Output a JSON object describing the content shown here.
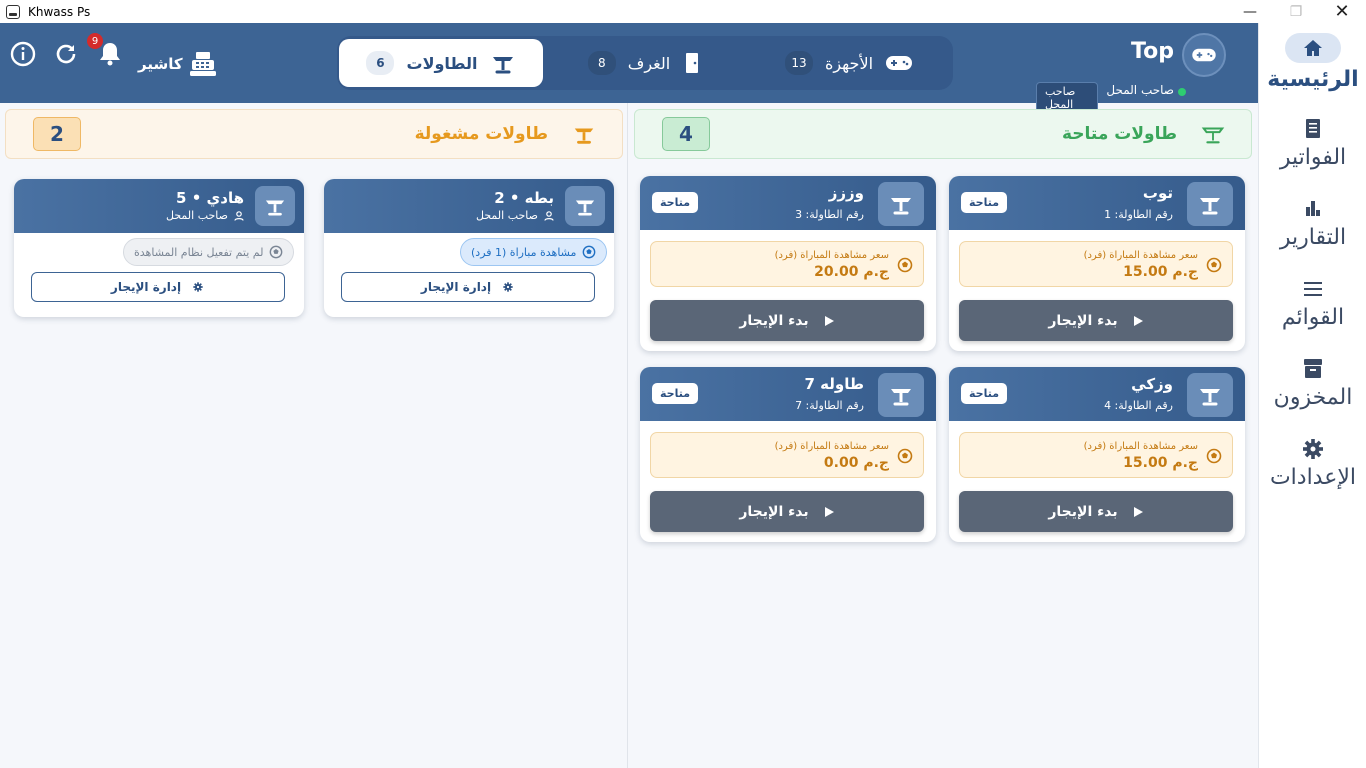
{
  "window": {
    "title": "Khwass Ps"
  },
  "sidebar": {
    "items": [
      {
        "label": "الرئيسية",
        "icon": "home-icon"
      },
      {
        "label": "الفواتير",
        "icon": "receipt-icon"
      },
      {
        "label": "التقارير",
        "icon": "bar-chart-icon"
      },
      {
        "label": "القوائم",
        "icon": "menu-icon"
      },
      {
        "label": "المخزون",
        "icon": "archive-icon"
      },
      {
        "label": "الإعدادات",
        "icon": "gear-icon"
      }
    ]
  },
  "header": {
    "notifications": "9",
    "cashier_label": "كاشير",
    "tabs": [
      {
        "label": "الطاولات",
        "count": "6"
      },
      {
        "label": "الغرف",
        "count": "8"
      },
      {
        "label": "الأجهزة",
        "count": "13"
      }
    ],
    "user": {
      "name": "Top",
      "role": "صاحب المحل",
      "role_badge": "صاحب المحل"
    }
  },
  "available": {
    "title": "طاولات متاحة",
    "count": "4",
    "cards": [
      {
        "name": "توب",
        "number": "رقم الطاولة: 1",
        "status": "متاحة",
        "price_label": "سعر مشاهدة المباراة (فرد)",
        "price": "15.00 ج.م",
        "action": "بدء الإيجار"
      },
      {
        "name": "وززز",
        "number": "رقم الطاولة: 3",
        "status": "متاحة",
        "price_label": "سعر مشاهدة المباراة (فرد)",
        "price": "20.00 ج.م",
        "action": "بدء الإيجار"
      },
      {
        "name": "وزكي",
        "number": "رقم الطاولة: 4",
        "status": "متاحة",
        "price_label": "سعر مشاهدة المباراة (فرد)",
        "price": "15.00 ج.م",
        "action": "بدء الإيجار"
      },
      {
        "name": "طاوله 7",
        "number": "رقم الطاولة: 7",
        "status": "متاحة",
        "price_label": "سعر مشاهدة المباراة (فرد)",
        "price": "0.00 ج.م",
        "action": "بدء الإيجار"
      }
    ]
  },
  "busy": {
    "title": "طاولات مشغولة",
    "count": "2",
    "cards": [
      {
        "name": "بطه • 2",
        "owner": "صاحب المحل",
        "chip": "مشاهدة مباراة (1 فرد)",
        "action": "إدارة الإيجار"
      },
      {
        "name": "هادي • 5",
        "owner": "صاحب المحل",
        "chip": "لم يتم تفعيل نظام المشاهدة",
        "action": "إدارة الإيجار"
      }
    ]
  },
  "colors": {
    "header": "#3d6494",
    "available": "#3aa55a",
    "busy": "#e6991e",
    "price": "#c47a12"
  }
}
